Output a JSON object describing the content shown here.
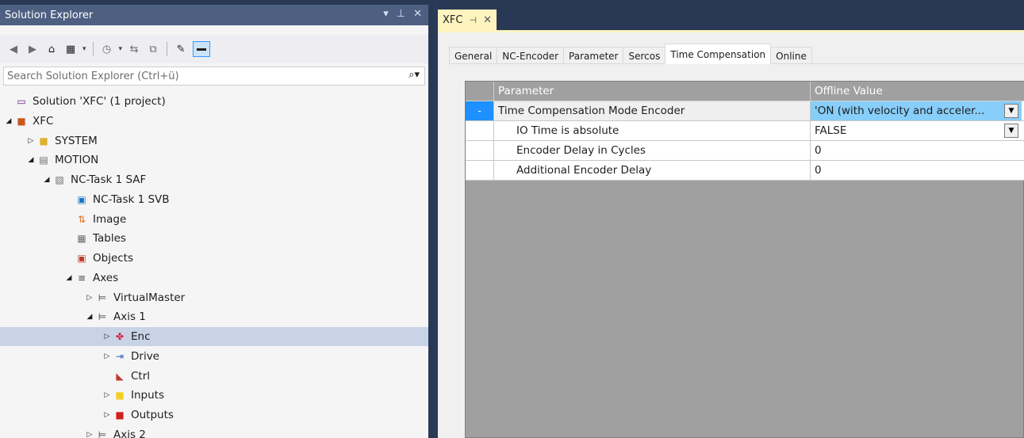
{
  "solution_explorer": {
    "title": "Solution Explorer",
    "title_controls": [
      "▾",
      "⊥",
      "✕"
    ],
    "search_placeholder": "Search Solution Explorer (Ctrl+ü)",
    "tree": [
      {
        "label": "Solution 'XFC' (1 project)",
        "level": 0,
        "expander": "",
        "icon": "solution-icon"
      },
      {
        "label": "XFC",
        "level": 0,
        "expander": "◢",
        "icon": "plc-project-icon"
      },
      {
        "label": "SYSTEM",
        "level": 1,
        "expander": "▷",
        "icon": "system-icon"
      },
      {
        "label": "MOTION",
        "level": 1,
        "expander": "◢",
        "icon": "motion-icon"
      },
      {
        "label": "NC-Task 1 SAF",
        "level": 2,
        "expander": "◢",
        "icon": "nc-task-icon"
      },
      {
        "label": "NC-Task 1 SVB",
        "level": 3,
        "expander": "",
        "icon": "nc-task-svb-icon"
      },
      {
        "label": "Image",
        "level": 3,
        "expander": "",
        "icon": "image-icon"
      },
      {
        "label": "Tables",
        "level": 3,
        "expander": "",
        "icon": "tables-icon"
      },
      {
        "label": "Objects",
        "level": 3,
        "expander": "",
        "icon": "objects-icon"
      },
      {
        "label": "Axes",
        "level": 3,
        "expander": "◢",
        "icon": "axes-icon"
      },
      {
        "label": "VirtualMaster",
        "level": 4,
        "expander": "▷",
        "icon": "axis-icon"
      },
      {
        "label": "Axis 1",
        "level": 4,
        "expander": "◢",
        "icon": "axis-icon"
      },
      {
        "label": "Enc",
        "level": 5,
        "expander": "▷",
        "icon": "encoder-icon",
        "selected": true
      },
      {
        "label": "Drive",
        "level": 5,
        "expander": "▷",
        "icon": "drive-icon"
      },
      {
        "label": "Ctrl",
        "level": 5,
        "expander": "",
        "icon": "ctrl-icon"
      },
      {
        "label": "Inputs",
        "level": 5,
        "expander": "▷",
        "icon": "inputs-icon"
      },
      {
        "label": "Outputs",
        "level": 5,
        "expander": "▷",
        "icon": "outputs-icon"
      },
      {
        "label": "Axis 2",
        "level": 4,
        "expander": "▷",
        "icon": "axis-icon"
      }
    ]
  },
  "document": {
    "tab_label": "XFC",
    "tab_pin": "⊣",
    "tab_close": "✕",
    "property_tabs": [
      "General",
      "NC-Encoder",
      "Parameter",
      "Sercos",
      "Time Compensation",
      "Online"
    ],
    "active_tab": "Time Compensation",
    "grid": {
      "headers": {
        "parameter": "Parameter",
        "value": "Offline Value"
      },
      "rows": [
        {
          "marker": "-",
          "parameter": "Time Compensation Mode Encoder",
          "value": "'ON (with velocity and acceler...",
          "dropdown": true,
          "indent": false
        },
        {
          "marker": "",
          "parameter": "IO Time is absolute",
          "value": "FALSE",
          "dropdown": true,
          "indent": true
        },
        {
          "marker": "",
          "parameter": "Encoder Delay in Cycles",
          "value": "0",
          "dropdown": false,
          "indent": true
        },
        {
          "marker": "",
          "parameter": "Additional Encoder Delay",
          "value": "0",
          "dropdown": false,
          "indent": true
        }
      ]
    }
  }
}
